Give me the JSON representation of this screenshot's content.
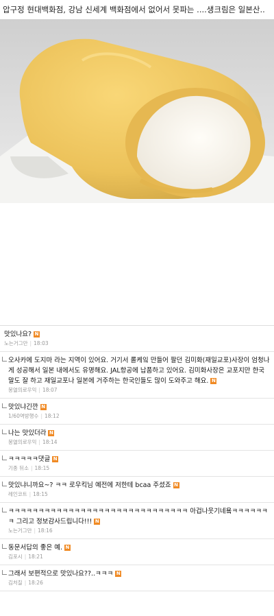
{
  "article": {
    "title": "압구정 현대백화점, 강남 신세계 백화점에서 없어서 못파는 ....생크림은 일본산.."
  },
  "colors": {
    "badge": "#f08a24",
    "meta": "#999999",
    "divider": "#e3e3e3"
  },
  "icons": {
    "new_badge": "N"
  },
  "comments": [
    {
      "text": "맛있나요?",
      "author": "노는거그만",
      "time": "18:03"
    },
    {
      "text": "오사카에 도지마 라는 지역이 있어요. 거기서 롤케잌 만들어 팔던 김미화(재일교포)사장이 엄청나게 성공해서 일본 내에서도 유명해요. JAL항공에 납품하고 있어요. 김미화사장은 교포지만 한국말도 잘 하고 재일교포나 일본에 거주하는 한국인들도 많이 도와주고 해요.",
      "author": "봉열의로우익",
      "time": "18:07"
    },
    {
      "text": "맛있냐긴깐",
      "author": "1/60역방행수",
      "time": "18:12"
    },
    {
      "text": "나는 맛있더라",
      "author": "봉열의로우익",
      "time": "18:14"
    },
    {
      "text": "ㅋㅋㅋㅋㅋ댓글",
      "author": "기종 뒤소",
      "time": "18:15"
    },
    {
      "text": "맛있냐니까요~? ㅋㅋ 로우킥님 예전에 저한테 bcaa 주셨죠",
      "author": "레인코트",
      "time": "18:15"
    },
    {
      "text": "ㅋㅋㅋㅋㅋㅋㅋㅋㅋㅋㅋㅋㅋㅋㅋㅋㅋㅋㅋㅋㅋㅋㅋㅋㅋㅋㅋㅋㅋㅋ 아겁나웃기네욬ㅋㅋㅋㅋㅋㅋㅋ 그리고 정보감사드립니다!!!",
      "author": "노는거그만",
      "time": "18:16"
    },
    {
      "text": "동문서답의 좋은 예.",
      "author": "김포시",
      "time": "18:21"
    },
    {
      "text": "그래서 보편적으로 맛있나요??..ㅋㅋㅋ",
      "author": "김처칠",
      "time": "18:26"
    }
  ]
}
